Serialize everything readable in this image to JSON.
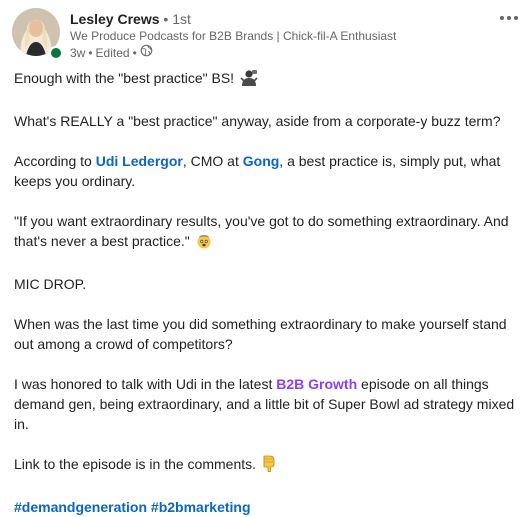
{
  "author": {
    "name": "Lesley Crews",
    "degree": "1st",
    "tagline": "We Produce Podcasts for B2B Brands | Chick-fil-A Enthusiast",
    "time": "3w",
    "edited": "Edited"
  },
  "separators": {
    "bullet": "•"
  },
  "post": {
    "p1": "Enough with the \"best practice\" BS!",
    "p2": "What's REALLY a \"best practice\" anyway, aside from a corporate-y buzz term?",
    "p3_before": "According to ",
    "p3_person": "Udi Ledergor",
    "p3_mid": ", CMO at ",
    "p3_company": "Gong",
    "p3_after": ", a best practice is, simply put, what keeps you ordinary.",
    "p4": "\"If you want extraordinary results, you've got to do something extraordinary. And that's never a best practice.\"",
    "p5": "MIC DROP.",
    "p6": "When was the last time you did something extraordinary to make yourself stand out among a crowd of competitors?",
    "p7_before": "I was honored to talk with Udi in the latest ",
    "p7_show": "B2B Growth",
    "p7_after": " episode on all things demand gen, being extraordinary, and a little bit of Super Bowl ad strategy mixed in.",
    "p8": "Link to the episode is in the comments.",
    "hashtag1": "#demandgeneration",
    "hashtag2": "#b2bmarketing"
  },
  "icons": {
    "more": "more-horizontal-icon",
    "globe": "globe-icon",
    "person_raising_hand": "person-shrugging-emoji",
    "shocked": "exploding-head-emoji",
    "point_down": "backhand-index-pointing-down-emoji"
  },
  "colors": {
    "link": "#0a66c2",
    "show_link": "#8a3ffc",
    "online": "#057642",
    "meta": "#666666"
  }
}
